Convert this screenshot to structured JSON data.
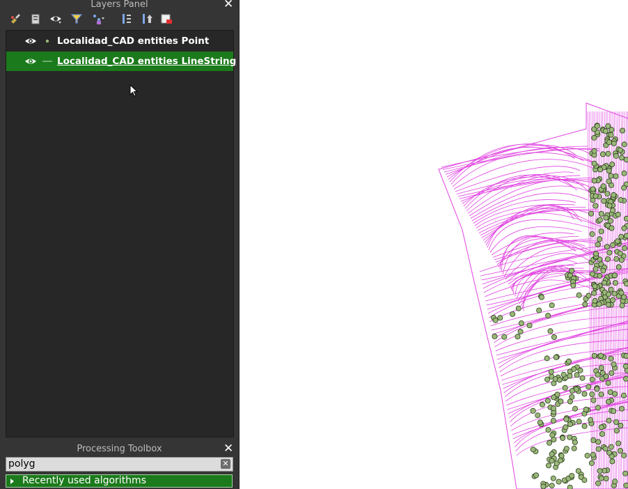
{
  "layers_panel": {
    "title": "Layers Panel",
    "toolbar": [
      {
        "icon": "style-brush-icon"
      },
      {
        "icon": "add-group-icon"
      },
      {
        "icon": "manage-visibility-icon"
      },
      {
        "icon": "filter-legend-icon"
      },
      {
        "icon": "filter-expression-icon"
      },
      {
        "icon": "expand-all-icon"
      },
      {
        "icon": "collapse-all-icon"
      },
      {
        "icon": "remove-layer-icon"
      }
    ],
    "layers": [
      {
        "name": "Localidad_CAD entities Point",
        "symbol": "point",
        "visible": true,
        "selected": false
      },
      {
        "name": "Localidad_CAD entities LineString",
        "symbol": "line",
        "visible": true,
        "selected": true
      }
    ]
  },
  "processing_toolbox": {
    "title": "Processing Toolbox",
    "search_value": "polyg",
    "groups": [
      {
        "label": "Recently used algorithms",
        "expanded": false
      }
    ]
  },
  "colors": {
    "line_layer": "#e040e0",
    "point_fill": "#9ab87a",
    "point_stroke": "#2a3a1a",
    "selection": "#1b7a1b"
  }
}
